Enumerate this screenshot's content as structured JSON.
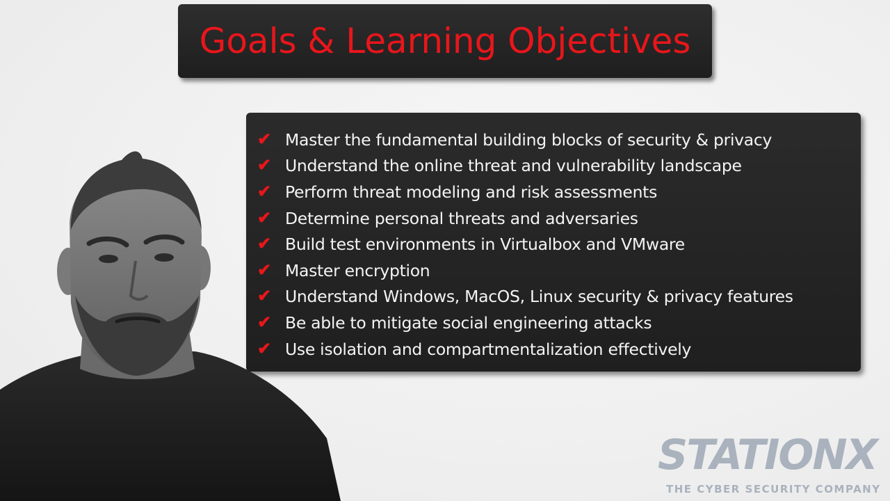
{
  "title": "Goals & Learning Objectives",
  "objectives": [
    "Master the fundamental building blocks of security & privacy",
    "Understand the online threat and vulnerability landscape",
    "Perform threat modeling and risk assessments",
    "Determine personal threats and adversaries",
    "Build test environments in Virtualbox and VMware",
    "Master encryption",
    "Understand Windows, MacOS, Linux security & privacy features",
    "Be able to mitigate social engineering attacks",
    "Use isolation and compartmentalization effectively"
  ],
  "check_glyph": "✔",
  "logo": {
    "wordmark": "STATIONX",
    "tagline": "THE CYBER SECURITY COMPANY"
  },
  "colors": {
    "accent": "#e8161b",
    "panel": "#262626",
    "text": "#f4f4f4",
    "logo": "#a9b2bd"
  },
  "icons": {
    "bullet": "checkmark-icon"
  }
}
